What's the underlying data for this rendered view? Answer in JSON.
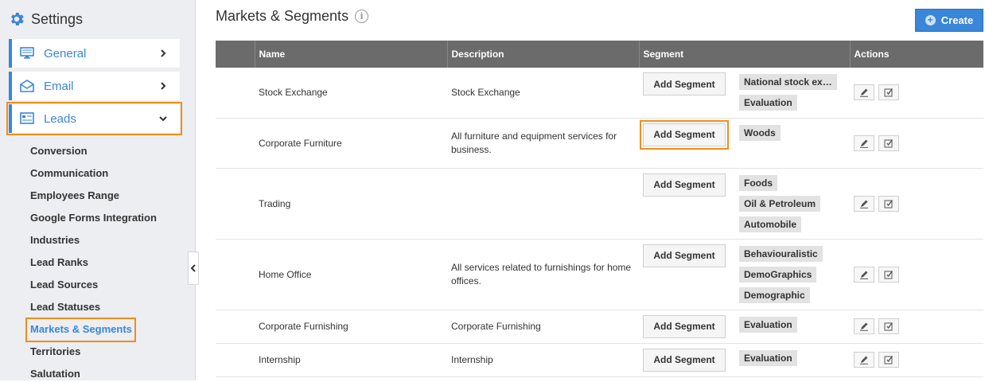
{
  "sidebar": {
    "title": "Settings",
    "nav": [
      {
        "label": "General",
        "icon": "monitor-icon",
        "expanded": false
      },
      {
        "label": "Email",
        "icon": "envelope-icon",
        "expanded": false
      },
      {
        "label": "Leads",
        "icon": "leads-icon",
        "expanded": true
      }
    ],
    "sub_items": [
      "Conversion",
      "Communication",
      "Employees Range",
      "Google Forms Integration",
      "Industries",
      "Lead Ranks",
      "Lead Sources",
      "Lead Statuses",
      "Markets & Segments",
      "Territories",
      "Salutation"
    ],
    "active_sub": "Markets & Segments"
  },
  "main": {
    "title": "Markets & Segments",
    "info_glyph": "i",
    "create_label": "Create",
    "columns": [
      "",
      "Name",
      "Description",
      "Segment",
      "Actions"
    ],
    "add_segment_label": "Add Segment",
    "rows": [
      {
        "name": "Stock Exchange",
        "description": "Stock Exchange",
        "segments": [
          "National stock ex…",
          "Evaluation"
        ]
      },
      {
        "name": "Corporate Furniture",
        "description": "All furniture and equipment services for business.",
        "segments": [
          "Woods"
        ]
      },
      {
        "name": "Trading",
        "description": "",
        "segments": [
          "Foods",
          "Oil & Petroleum",
          "Automobile"
        ]
      },
      {
        "name": "Home Office",
        "description": "All services related to furnishings for home offices.",
        "segments": [
          "Behaviouralistic",
          "DemoGraphics",
          "Demographic"
        ]
      },
      {
        "name": "Corporate Furnishing",
        "description": "Corporate Furnishing",
        "segments": [
          "Evaluation"
        ]
      },
      {
        "name": "Internship",
        "description": "Internship",
        "segments": [
          "Evaluation"
        ]
      }
    ]
  },
  "colors": {
    "accent": "#3a86d8",
    "highlight": "#f28c18",
    "header_bg": "#6b6b6b"
  }
}
